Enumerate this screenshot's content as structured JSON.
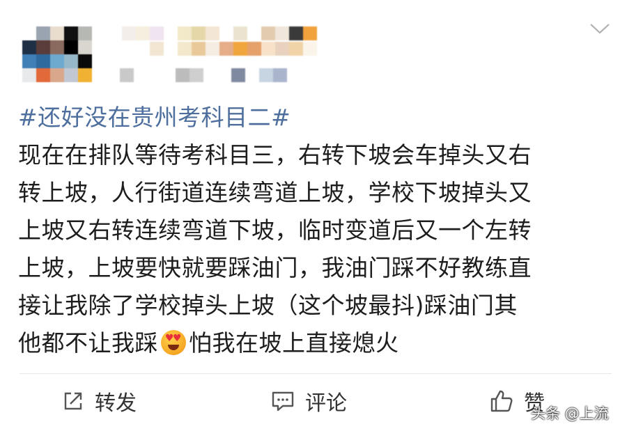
{
  "post": {
    "hashtag": "#还好没在贵州考科目二#",
    "body_lines": [
      "现在在排队等待考科目三，右转下坡会车掉头又右",
      "转上坡，人行街道连续弯道上坡，学校下坡掉头又",
      "上坡又右转连续弯道下坡，临时变道后又一个左转",
      "上坡，上坡要快就要踩油门，我油门踩不好教练直",
      "接让我除了学校掉头上坡（这个坡最抖)踩油门其"
    ],
    "last_line_before": "他都不让我踩",
    "last_line_emoji": "heart-eyes-emoji",
    "last_line_after": "怕我在坡上直接熄火"
  },
  "actions": {
    "repost_label": "转发",
    "comment_label": "评论",
    "like_label": "赞"
  },
  "watermark": "头条 @上流",
  "colors": {
    "hashtag": "#4e6f9e",
    "text": "#1d1d1d"
  }
}
